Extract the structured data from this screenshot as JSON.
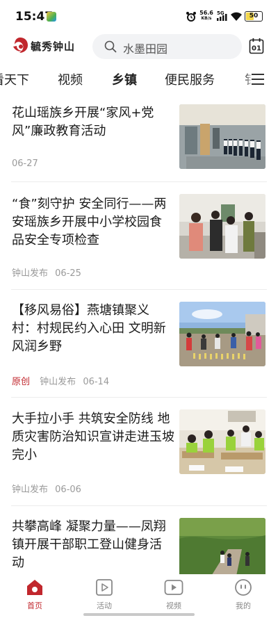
{
  "status_bar": {
    "time": "15:47",
    "net_speed_value": "56.6",
    "net_speed_unit": "KB/s",
    "network": "5G",
    "battery": "50"
  },
  "header": {
    "logo_text": "毓秀钟山",
    "search_placeholder": "水墨田园",
    "calendar_day": "01"
  },
  "tabs": [
    {
      "label": "看天下",
      "active": false
    },
    {
      "label": "视频",
      "active": false
    },
    {
      "label": "乡镇",
      "active": true
    },
    {
      "label": "便民服务",
      "active": false
    },
    {
      "label": "钅",
      "active": false
    }
  ],
  "articles": [
    {
      "title": "花山瑶族乡开展“家风+党风”廉政教育活动",
      "original": "",
      "source": "",
      "date": "06-27",
      "thumb_icon": "meeting-room-photo"
    },
    {
      "title": "“食”刻守护  安全同行——两安瑶族乡开展中小学校园食品安全专项检查",
      "original": "",
      "source": "钟山发布",
      "date": "06-25",
      "thumb_icon": "kitchen-inspection-photo"
    },
    {
      "title": "【移风易俗】燕塘镇聚义村：村规民约入心田 文明新风润乡野",
      "original": "原创",
      "source": "钟山发布",
      "date": "06-14",
      "thumb_icon": "village-event-photo"
    },
    {
      "title": "大手拉小手 共筑安全防线 地质灾害防治知识宣讲走进玉坡完小",
      "original": "",
      "source": "钟山发布",
      "date": "06-06",
      "thumb_icon": "classroom-photo"
    },
    {
      "title": "共攀高峰 凝聚力量——凤翔镇开展干部职工登山健身活动",
      "original": "",
      "source": "",
      "date": "",
      "thumb_icon": "hiking-photo"
    }
  ],
  "bottom_nav": [
    {
      "label": "首页",
      "icon": "home-icon",
      "active": true
    },
    {
      "label": "活动",
      "icon": "activity-icon",
      "active": false
    },
    {
      "label": "视频",
      "icon": "video-icon",
      "active": false
    },
    {
      "label": "我的",
      "icon": "profile-icon",
      "active": false
    }
  ],
  "colors": {
    "brand_red": "#c1272d",
    "meta_gray": "#9a9a9a"
  }
}
